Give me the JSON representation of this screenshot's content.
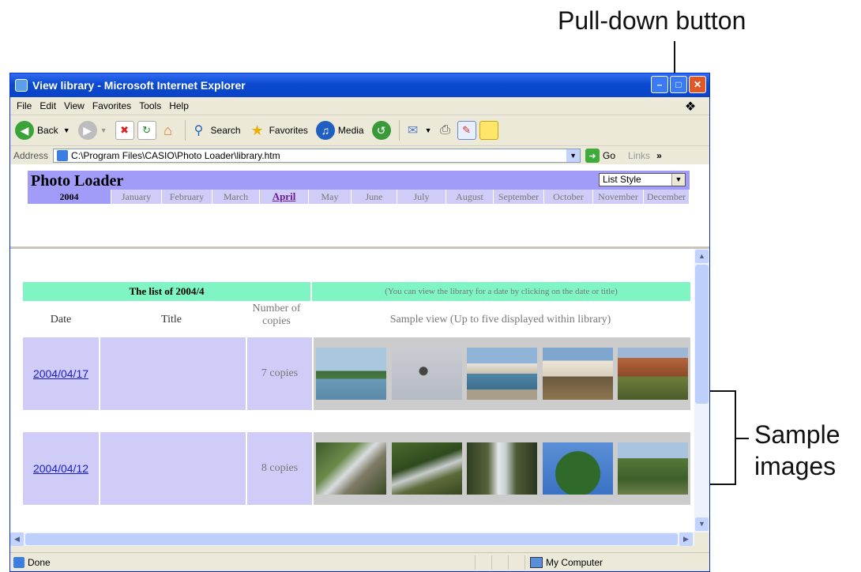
{
  "callouts": {
    "pulldown": "Pull-down button",
    "sample_line1": "Sample",
    "sample_line2": "images"
  },
  "window": {
    "title": "View library - Microsoft Internet Explorer",
    "menu": [
      "File",
      "Edit",
      "View",
      "Favorites",
      "Tools",
      "Help"
    ],
    "toolbar": {
      "back": "Back",
      "search": "Search",
      "favorites": "Favorites",
      "media": "Media"
    },
    "address": {
      "label": "Address",
      "value": "C:\\Program Files\\CASIO\\Photo Loader\\library.htm",
      "go": "Go",
      "links": "Links"
    },
    "status": {
      "left": "Done",
      "zone": "My Computer"
    }
  },
  "app": {
    "title": "Photo Loader",
    "view_select": "List Style",
    "year": "2004",
    "months": [
      "January",
      "February",
      "March",
      "April",
      "May",
      "June",
      "July",
      "August",
      "September",
      "October",
      "November",
      "December"
    ],
    "current_month": "April"
  },
  "library": {
    "heading": "The list of 2004/4",
    "hint": "(You can view the library for a date by clicking on the date or title)",
    "columns": {
      "date": "Date",
      "title": "Title",
      "copies_line1": "Number of",
      "copies_line2": "copies",
      "sample": "Sample view (Up to five displayed within library)"
    },
    "rows": [
      {
        "date": "2004/04/17",
        "title": "",
        "copies": "7 copies"
      },
      {
        "date": "2004/04/12",
        "title": "",
        "copies": "8 copies"
      }
    ]
  }
}
